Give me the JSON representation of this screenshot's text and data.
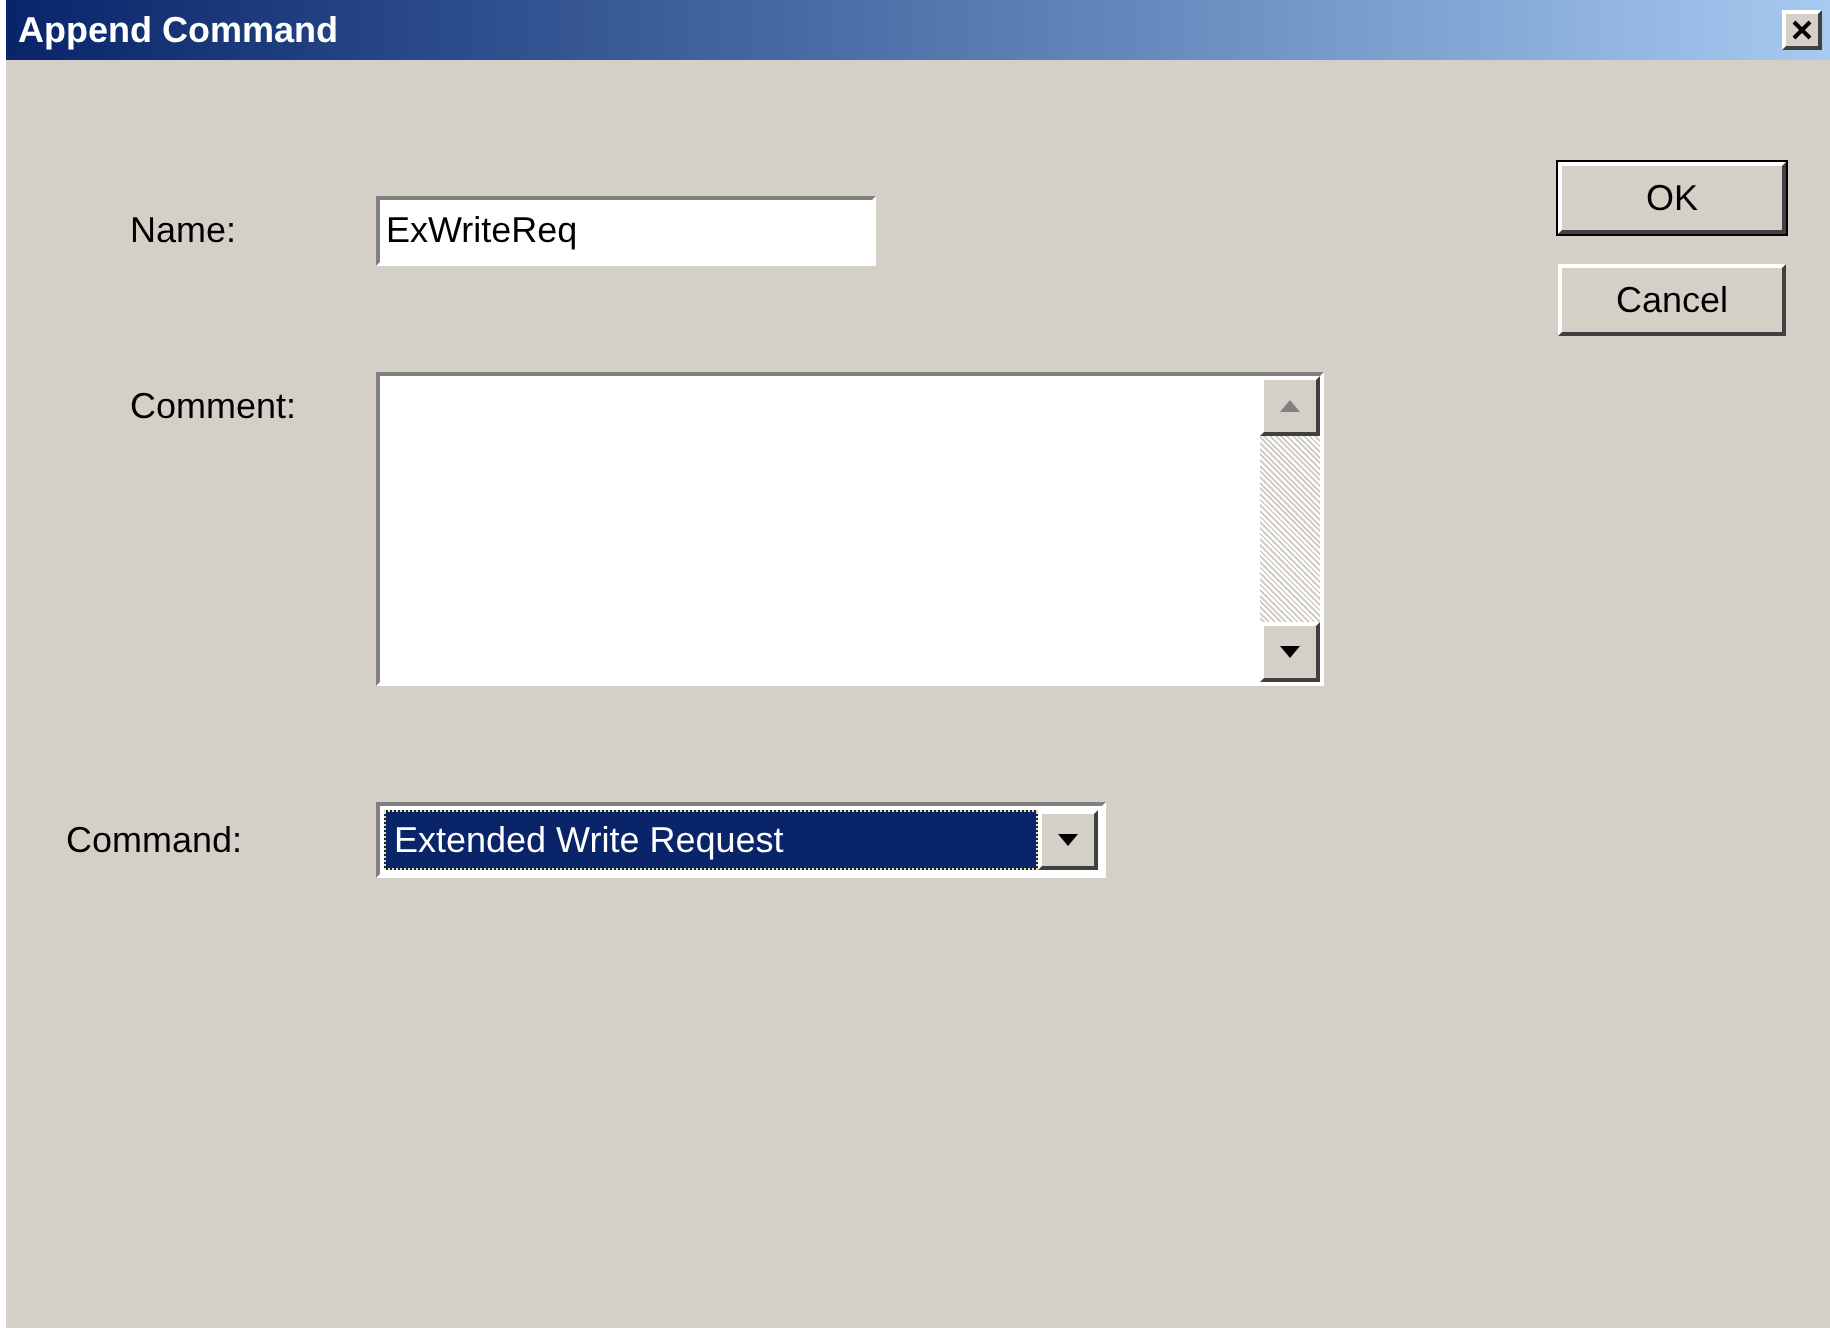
{
  "window": {
    "title": "Append Command"
  },
  "name_field": {
    "label": "Name:",
    "value": "ExWriteReq"
  },
  "comment_field": {
    "label": "Comment:"
  },
  "command_field": {
    "label": "Command:",
    "value": "Extended Write Request",
    "selected": true
  },
  "buttons": [
    {
      "label": "OK",
      "default": true
    },
    {
      "label": "Cancel",
      "default": false
    }
  ]
}
